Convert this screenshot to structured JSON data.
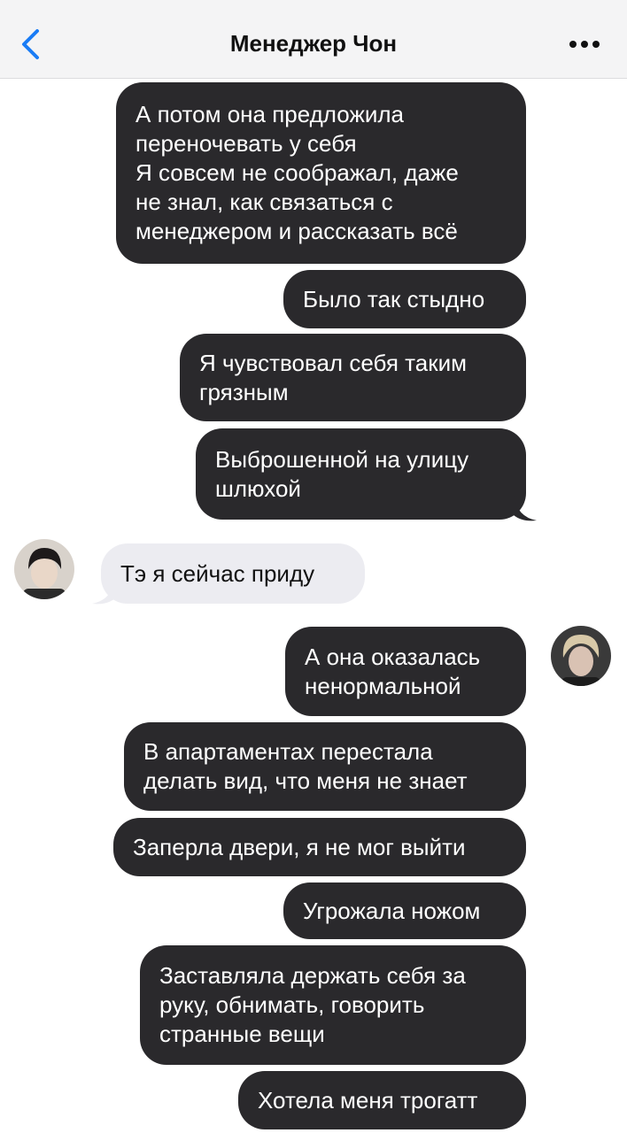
{
  "header": {
    "title": "Менеджер Чон",
    "back_icon": "chevron-left-icon",
    "more_icon": "ellipsis-icon",
    "accent": "#1a7cf5"
  },
  "messages": [
    {
      "side": "out",
      "text": "А потом она предложила\nпереночевать у себя\nЯ совсем не соображал, даже\nне знал, как связаться с\nменеджером и рассказать всё"
    },
    {
      "side": "out",
      "text": "Было так стыдно"
    },
    {
      "side": "out",
      "text": "Я чувствовал себя таким\nгрязным"
    },
    {
      "side": "out",
      "text": "Выброшенной на улицу\nшлюхой"
    },
    {
      "side": "in",
      "text": "Тэ я сейчас приду"
    },
    {
      "side": "out",
      "text": "А она оказалась\nненормальной"
    },
    {
      "side": "out",
      "text": "В апартаментах перестала\nделать вид, что меня не знает"
    },
    {
      "side": "out",
      "text": "Заперла двери, я не мог выйти"
    },
    {
      "side": "out",
      "text": "Угрожала ножом"
    },
    {
      "side": "out",
      "text": "Заставляла держать себя за\nруку, обнимать, говорить\nстранные вещи"
    },
    {
      "side": "out",
      "text": "Хотела меня трогатт"
    }
  ],
  "colors": {
    "outgoing_bubble": "#2a292c",
    "incoming_bubble": "#ececf1"
  }
}
